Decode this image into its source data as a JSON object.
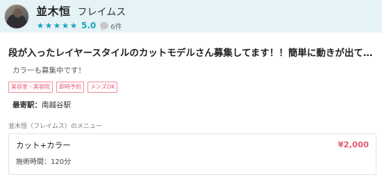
{
  "header": {
    "stylist_name": "並木恒",
    "salon_name": "フレイムス",
    "rating": "5.0",
    "stars": 5,
    "review_count": "6件",
    "accent_color": "#1aa3bf",
    "icons": [
      "avatar",
      "star-icon",
      "review-bubble-icon"
    ]
  },
  "post": {
    "headline": "段が入ったレイヤースタイルのカットモデルさん募集してます！！簡単に動きが出てかわいい",
    "subtext": "カラーも募集中です！",
    "tags": [
      "美容室・美容院",
      "即時予約",
      "メンズOK"
    ],
    "station_label": "最寄駅：",
    "station_value": "南越谷駅"
  },
  "menu": {
    "section_title": "並木恒（フレイムス）のメニュー",
    "items": [
      {
        "name": "カット+カラー",
        "price": "¥2,000",
        "time": "施術時間：120分"
      }
    ],
    "price_color": "#e45a72"
  }
}
